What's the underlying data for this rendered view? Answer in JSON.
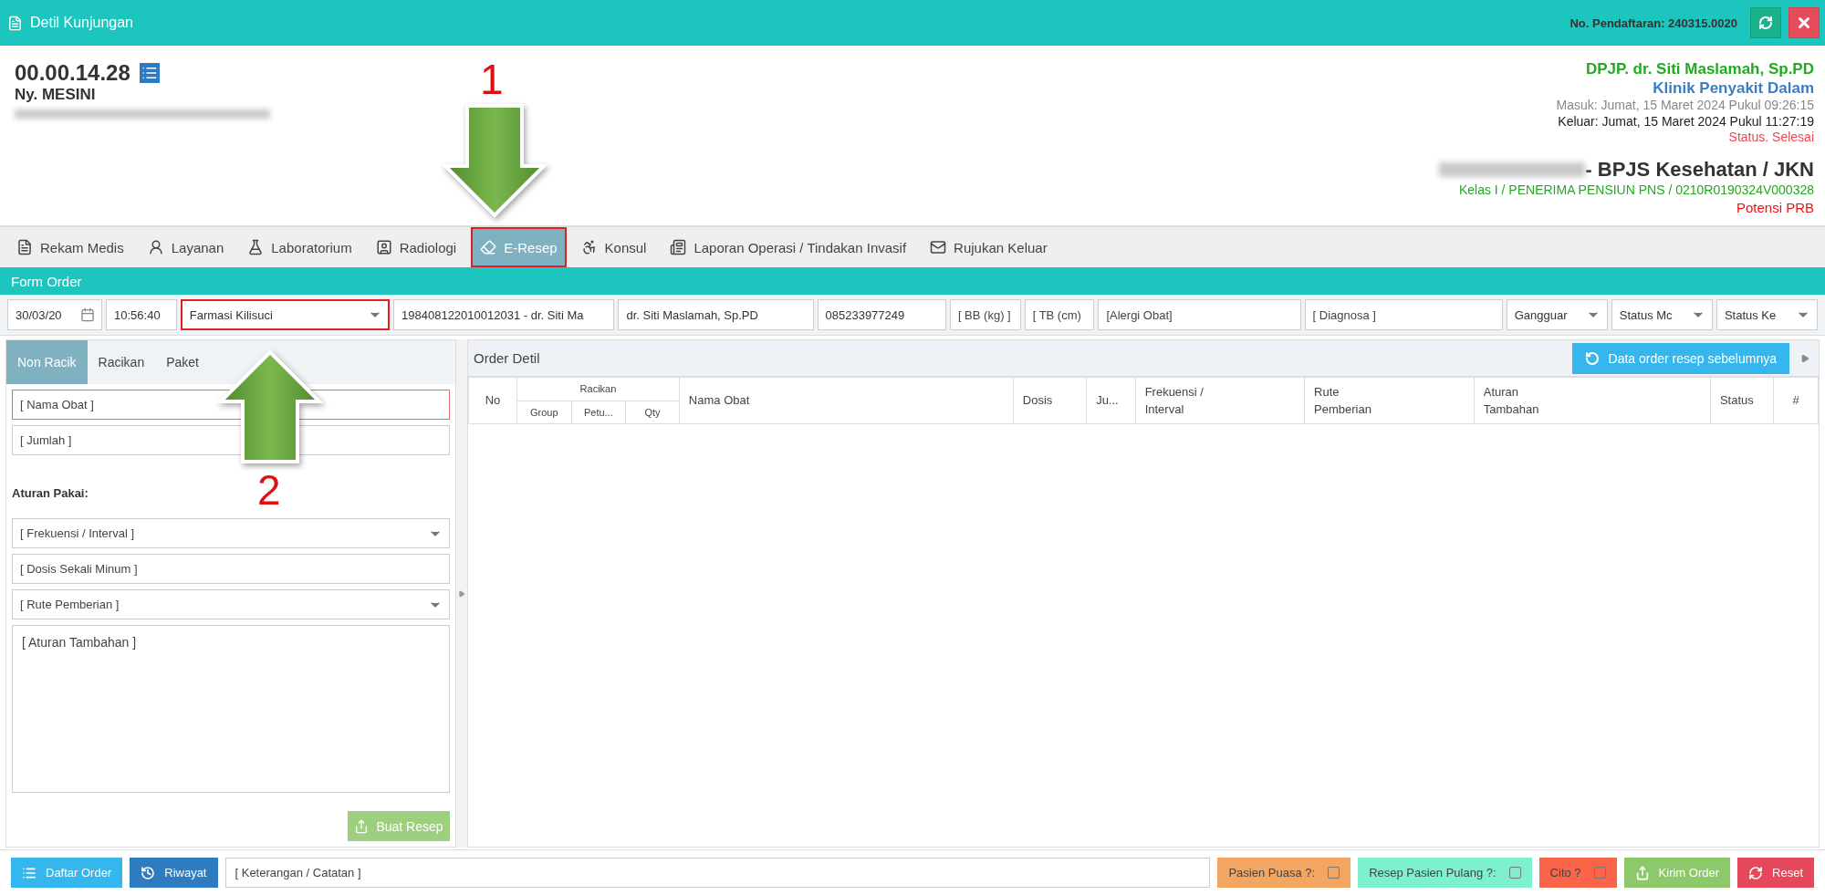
{
  "window": {
    "title": "Detil Kunjungan",
    "registration": "No. Pendaftaran: 240315.0020"
  },
  "patient": {
    "record_number": "00.00.14.28",
    "name": "Ny. MESINI"
  },
  "visit": {
    "dpjp": "DPJP. dr. Siti Maslamah, Sp.PD",
    "clinic": "Klinik Penyakit Dalam",
    "entry": "Masuk: Jumat, 15 Maret 2024 Pukul 09:26:15",
    "exit": "Keluar: Jumat, 15 Maret 2024 Pukul 11:27:19",
    "status": "Status. Selesai",
    "insurance": "- BPJS Kesehatan / JKN",
    "class_line": "Kelas I / PENERIMA PENSIUN PNS / 0210R0190324V000328",
    "note": "Potensi PRB"
  },
  "tabs": [
    {
      "label": "Rekam Medis",
      "selected": false,
      "highlighted": false
    },
    {
      "label": "Layanan",
      "selected": false,
      "highlighted": false
    },
    {
      "label": "Laboratorium",
      "selected": false,
      "highlighted": false
    },
    {
      "label": "Radiologi",
      "selected": false,
      "highlighted": false
    },
    {
      "label": "E-Resep",
      "selected": true,
      "highlighted": true
    },
    {
      "label": "Konsul",
      "selected": false,
      "highlighted": false
    },
    {
      "label": "Laporan Operasi / Tindakan Invasif",
      "selected": false,
      "highlighted": false
    },
    {
      "label": "Rujukan Keluar",
      "selected": false,
      "highlighted": false
    }
  ],
  "form_order": {
    "title": "Form Order",
    "fields": [
      {
        "kind": "date",
        "value": "30/03/20",
        "highlighted": false
      },
      {
        "kind": "text",
        "value": "10:56:40",
        "highlighted": false
      },
      {
        "kind": "select",
        "value": "Farmasi Kilisuci",
        "highlighted": true
      },
      {
        "kind": "text",
        "value": "198408122010012031 - dr. Siti Ma",
        "highlighted": false
      },
      {
        "kind": "text",
        "value": "dr. Siti Maslamah, Sp.PD",
        "highlighted": false
      },
      {
        "kind": "text",
        "value": "085233977249",
        "highlighted": false
      },
      {
        "kind": "text",
        "placeholder": "[ BB (kg) ]",
        "highlighted": false
      },
      {
        "kind": "text",
        "placeholder": "[ TB (cm)",
        "highlighted": false
      },
      {
        "kind": "text",
        "placeholder": "[Alergi Obat]",
        "highlighted": false
      },
      {
        "kind": "text",
        "placeholder": "[ Diagnosa ]",
        "highlighted": false
      },
      {
        "kind": "select",
        "value": "Gangguar",
        "highlighted": false
      },
      {
        "kind": "select",
        "value": "Status Mc",
        "highlighted": false
      },
      {
        "kind": "select",
        "value": "Status Ke",
        "highlighted": false
      }
    ]
  },
  "entry_tabs": [
    {
      "label": "Non Racik",
      "selected": true
    },
    {
      "label": "Racikan",
      "selected": false
    },
    {
      "label": "Paket",
      "selected": false
    }
  ],
  "entry_form": {
    "fields": [
      {
        "kind": "text",
        "placeholder": "[ Nama Obat ]",
        "invalid": true
      },
      {
        "kind": "text",
        "placeholder": "[ Jumlah ]",
        "invalid": false
      },
      {
        "kind": "label",
        "text": "Aturan Pakai:"
      },
      {
        "kind": "select",
        "placeholder": "[ Frekuensi / Interval ]",
        "invalid": false
      },
      {
        "kind": "text",
        "placeholder": "[ Dosis Sekali Minum ]",
        "invalid": false
      },
      {
        "kind": "select",
        "placeholder": "[ Rute Pemberian ]",
        "invalid": false
      },
      {
        "kind": "textarea",
        "placeholder": "[ Aturan Tambahan ]",
        "invalid": false
      }
    ],
    "submit": "Buat Resep"
  },
  "order_detail": {
    "title": "Order Detil",
    "history_button": "Data order resep sebelumnya",
    "columns": [
      {
        "label": "No"
      },
      {
        "label": "Racikan",
        "children": [
          {
            "label": "Group"
          },
          {
            "label": "Petu..."
          },
          {
            "label": "Qty"
          }
        ]
      },
      {
        "label": "Nama Obat"
      },
      {
        "label": "Dosis"
      },
      {
        "label": "Ju..."
      },
      {
        "label": "Frekuensi /\nInterval"
      },
      {
        "label": "Rute\nPemberian"
      },
      {
        "label": "Aturan\nTambahan"
      },
      {
        "label": "Status"
      },
      {
        "label": "#"
      }
    ]
  },
  "bottom_bar": [
    {
      "kind": "button",
      "label": "Daftar Order",
      "color": "#35b6ec"
    },
    {
      "kind": "button",
      "label": "Riwayat",
      "color": "#2f7bbf"
    },
    {
      "kind": "field",
      "placeholder": "[ Keterangan / Catatan ]"
    },
    {
      "kind": "check",
      "label": "Pasien Puasa ?:",
      "color": "#f3a562",
      "checked": false
    },
    {
      "kind": "check",
      "label": "Resep Pasien Pulang ?:",
      "color": "#7df0d0",
      "checked": false
    },
    {
      "kind": "check",
      "label": "Cito ?",
      "color": "#fa6448",
      "checked": false
    },
    {
      "kind": "button",
      "label": "Kirim Order",
      "color": "#8dc96b"
    },
    {
      "kind": "button",
      "label": "Reset",
      "color": "#e4485a"
    }
  ],
  "annotations": [
    {
      "label": "1",
      "kind": "down"
    },
    {
      "label": "2",
      "kind": "up"
    }
  ]
}
